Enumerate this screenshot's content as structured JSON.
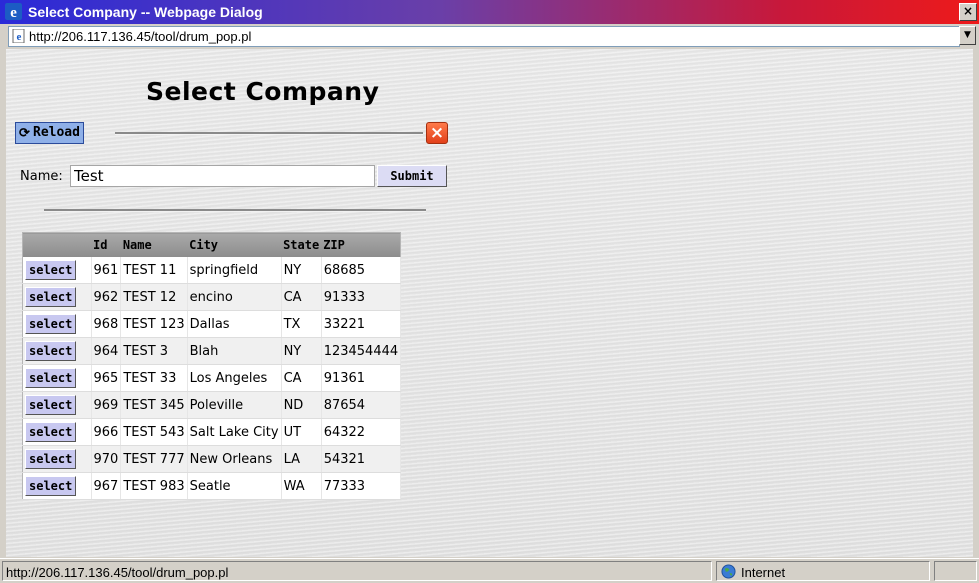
{
  "window": {
    "title": "Select Company -- Webpage Dialog",
    "close_glyph": "×",
    "address": "http://206.117.136.45/tool/drum_pop.pl"
  },
  "page": {
    "heading": "Select Company",
    "reload_label": "Reload",
    "close_glyph": "×",
    "name_label": "Name:",
    "name_value": "Test",
    "submit_label": "Submit"
  },
  "table": {
    "columns": [
      "",
      "Id",
      "Name",
      "City",
      "State",
      "ZIP"
    ],
    "select_label": "select",
    "rows": [
      {
        "id": "961",
        "name": "TEST 11",
        "city": "springfield",
        "state": "NY",
        "zip": "68685"
      },
      {
        "id": "962",
        "name": "TEST 12",
        "city": "encino",
        "state": "CA",
        "zip": "91333"
      },
      {
        "id": "968",
        "name": "TEST 123",
        "city": "Dallas",
        "state": "TX",
        "zip": "33221"
      },
      {
        "id": "964",
        "name": "TEST 3",
        "city": "Blah",
        "state": "NY",
        "zip": "123454444"
      },
      {
        "id": "965",
        "name": "TEST 33",
        "city": "Los Angeles",
        "state": "CA",
        "zip": "91361"
      },
      {
        "id": "969",
        "name": "TEST 345",
        "city": "Poleville",
        "state": "ND",
        "zip": "87654"
      },
      {
        "id": "966",
        "name": "TEST 543",
        "city": "Salt Lake City",
        "state": "UT",
        "zip": "64322"
      },
      {
        "id": "970",
        "name": "TEST 777",
        "city": "New Orleans",
        "state": "LA",
        "zip": "54321"
      },
      {
        "id": "967",
        "name": "TEST 983",
        "city": "Seatle",
        "state": "WA",
        "zip": "77333"
      }
    ]
  },
  "status": {
    "url": "http://206.117.136.45/tool/drum_pop.pl",
    "zone": "Internet"
  },
  "colors": {
    "title_gradient_start": "#2a2ad8",
    "title_gradient_end": "#ee1a1a",
    "select_button": "#c8c8f0",
    "reload_button": "#8fb0e8",
    "close_button": "#e2401a"
  },
  "icons": {
    "app": "ie-logo-icon",
    "address": "ie-page-icon",
    "reload": "refresh-icon",
    "zone": "globe-icon"
  }
}
